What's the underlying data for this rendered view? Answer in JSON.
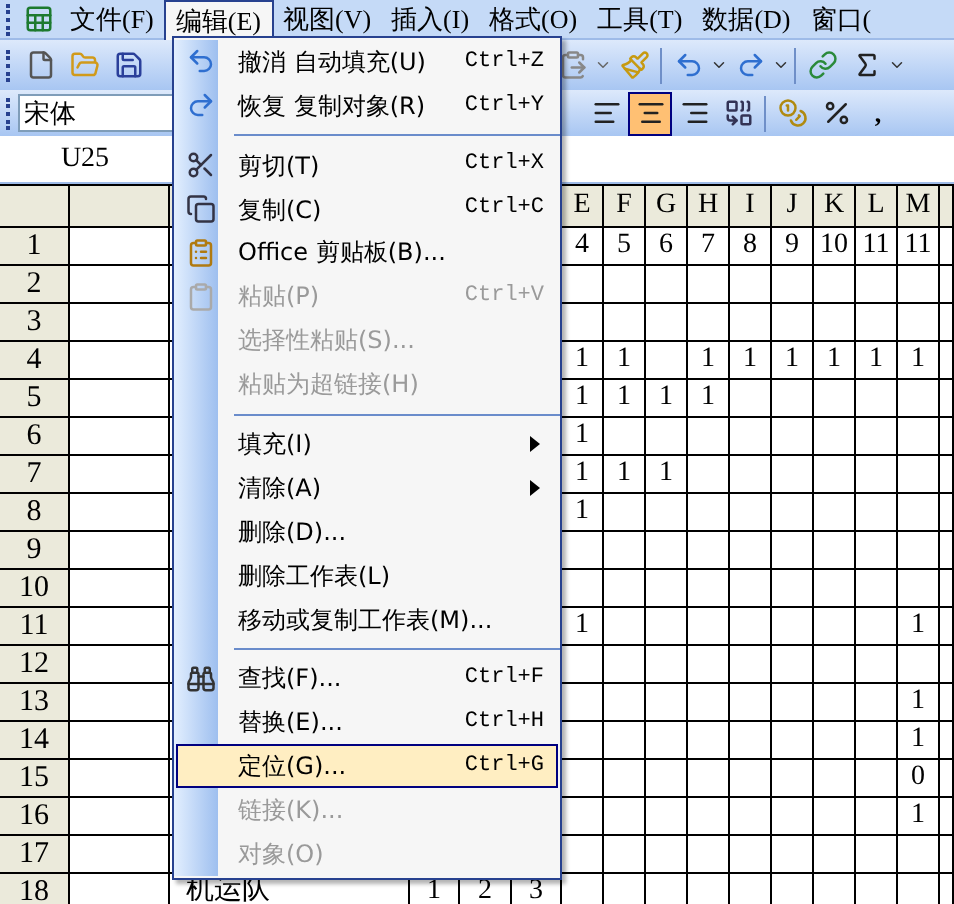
{
  "menu_bar": {
    "items": [
      {
        "label": "文件(F)",
        "selected": false
      },
      {
        "label": "编辑(E)",
        "selected": true
      },
      {
        "label": "视图(V)",
        "selected": false
      },
      {
        "label": "插入(I)",
        "selected": false
      },
      {
        "label": "格式(O)",
        "selected": false
      },
      {
        "label": "工具(T)",
        "selected": false
      },
      {
        "label": "数据(D)",
        "selected": false
      },
      {
        "label": "窗口(",
        "selected": false
      }
    ]
  },
  "formatting_toolbar": {
    "font": "宋体",
    "align_buttons": [
      {
        "selected": false
      },
      {
        "selected": true
      },
      {
        "selected": false
      }
    ],
    "comma_style": ","
  },
  "name_box": "U25",
  "column_headers": [
    "E",
    "F",
    "G",
    "H",
    "I",
    "J",
    "K",
    "L",
    "M"
  ],
  "rows": [
    {
      "header": "1",
      "cells": [
        null,
        null,
        null,
        null,
        null,
        "4",
        "5",
        "6",
        "7",
        "8",
        "9",
        "10",
        "11",
        "11",
        null
      ]
    },
    {
      "header": "2",
      "cells": []
    },
    {
      "header": "3",
      "cells": []
    },
    {
      "header": "4",
      "cells": [
        null,
        null,
        null,
        null,
        null,
        "1",
        "1",
        null,
        "1",
        "1",
        "1",
        "1",
        "1",
        "1",
        null
      ]
    },
    {
      "header": "5",
      "cells": [
        null,
        null,
        null,
        null,
        null,
        "1",
        "1",
        "1",
        "1",
        null,
        null,
        null,
        null,
        null,
        null
      ]
    },
    {
      "header": "6",
      "cells": [
        null,
        null,
        null,
        null,
        null,
        "1",
        null,
        null,
        null,
        null,
        null,
        null,
        null,
        null,
        null
      ]
    },
    {
      "header": "7",
      "cells": [
        null,
        null,
        null,
        null,
        null,
        "1",
        "1",
        "1",
        null,
        null,
        null,
        null,
        null,
        null,
        null
      ]
    },
    {
      "header": "8",
      "cells": [
        null,
        null,
        null,
        null,
        null,
        "1",
        null,
        null,
        null,
        null,
        null,
        null,
        null,
        null,
        null
      ]
    },
    {
      "header": "9",
      "cells": []
    },
    {
      "header": "10",
      "cells": []
    },
    {
      "header": "11",
      "cells": [
        null,
        null,
        null,
        null,
        null,
        "1",
        null,
        null,
        null,
        null,
        null,
        null,
        null,
        "1",
        null
      ]
    },
    {
      "header": "12",
      "cells": []
    },
    {
      "header": "13",
      "cells": [
        null,
        null,
        null,
        null,
        null,
        null,
        null,
        null,
        null,
        null,
        null,
        null,
        null,
        "1",
        null
      ]
    },
    {
      "header": "14",
      "cells": [
        null,
        null,
        null,
        null,
        null,
        null,
        null,
        null,
        null,
        null,
        null,
        null,
        null,
        "1",
        null
      ]
    },
    {
      "header": "15",
      "cells": [
        null,
        null,
        null,
        null,
        null,
        null,
        null,
        null,
        null,
        null,
        null,
        null,
        null,
        "0",
        null
      ]
    },
    {
      "header": "16",
      "cells": [
        null,
        null,
        null,
        null,
        null,
        null,
        null,
        null,
        null,
        null,
        null,
        null,
        null,
        "1",
        null
      ]
    },
    {
      "header": "17",
      "cells": []
    },
    {
      "header": "18",
      "cells": [
        null,
        "机运队",
        "1",
        "2",
        "3",
        null,
        null,
        null,
        null,
        null,
        null,
        null,
        null,
        null,
        null
      ]
    }
  ],
  "edit_menu": {
    "items": [
      {
        "kind": "item",
        "label": "撤消 自动填充(U)",
        "shortcut": "Ctrl+Z",
        "disabled": false,
        "selected": false
      },
      {
        "kind": "item",
        "label": "恢复 复制对象(R)",
        "shortcut": "Ctrl+Y",
        "disabled": false,
        "selected": false
      },
      {
        "kind": "separator"
      },
      {
        "kind": "item",
        "label": "剪切(T)",
        "shortcut": "Ctrl+X",
        "disabled": false,
        "selected": false
      },
      {
        "kind": "item",
        "label": "复制(C)",
        "shortcut": "Ctrl+C",
        "disabled": false,
        "selected": false
      },
      {
        "kind": "item",
        "label": "Office 剪贴板(B)...",
        "disabled": false,
        "selected": false
      },
      {
        "kind": "item",
        "label": "粘贴(P)",
        "shortcut": "Ctrl+V",
        "disabled": true,
        "selected": false
      },
      {
        "kind": "item",
        "label": "选择性粘贴(S)...",
        "disabled": true,
        "selected": false
      },
      {
        "kind": "item",
        "label": "粘贴为超链接(H)",
        "disabled": true,
        "selected": false
      },
      {
        "kind": "separator"
      },
      {
        "kind": "submenu",
        "label": "填充(I)",
        "disabled": false,
        "selected": false
      },
      {
        "kind": "submenu",
        "label": "清除(A)",
        "disabled": false,
        "selected": false
      },
      {
        "kind": "item",
        "label": "删除(D)...",
        "disabled": false,
        "selected": false
      },
      {
        "kind": "item",
        "label": "删除工作表(L)",
        "disabled": false,
        "selected": false
      },
      {
        "kind": "item",
        "label": "移动或复制工作表(M)...",
        "disabled": false,
        "selected": false
      },
      {
        "kind": "separator"
      },
      {
        "kind": "item",
        "label": "查找(F)...",
        "shortcut": "Ctrl+F",
        "disabled": false,
        "selected": false
      },
      {
        "kind": "item",
        "label": "替换(E)...",
        "shortcut": "Ctrl+H",
        "disabled": false,
        "selected": false
      },
      {
        "kind": "item",
        "label": "定位(G)...",
        "shortcut": "Ctrl+G",
        "disabled": false,
        "selected": true
      },
      {
        "kind": "item",
        "label": "链接(K)...",
        "disabled": true,
        "selected": false
      },
      {
        "kind": "item",
        "label": "对象(O)",
        "disabled": true,
        "selected": false
      }
    ]
  }
}
